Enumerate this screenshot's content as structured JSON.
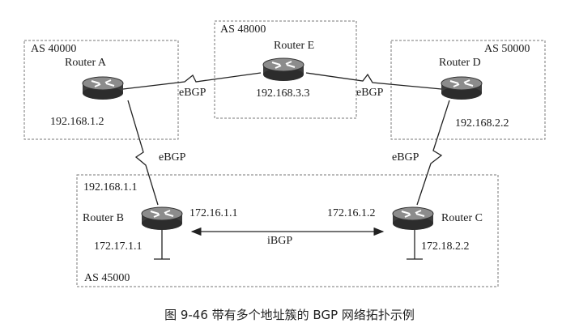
{
  "caption": "图 9-46    带有多个地址簇的 BGP 网络拓扑示例",
  "as_boxes": {
    "as40000": "AS 40000",
    "as48000": "AS 48000",
    "as50000": "AS 50000",
    "as45000": "AS 45000"
  },
  "routers": {
    "a": {
      "name": "Router A",
      "ip": "192.168.1.2"
    },
    "e": {
      "name": "Router E",
      "ip": "192.168.3.3"
    },
    "d": {
      "name": "Router D",
      "ip": "192.168.2.2"
    },
    "b": {
      "name": "Router B",
      "ip_top": "192.168.1.1",
      "ip_right": "172.16.1.1",
      "ip_lan": "172.17.1.1"
    },
    "c": {
      "name": "Router C",
      "ip_left": "172.16.1.2",
      "ip_lan": "172.18.2.2"
    }
  },
  "links": {
    "a_e": "eBGP",
    "e_d": "eBGP",
    "a_b": "eBGP",
    "d_c": "eBGP",
    "b_c": "iBGP"
  }
}
